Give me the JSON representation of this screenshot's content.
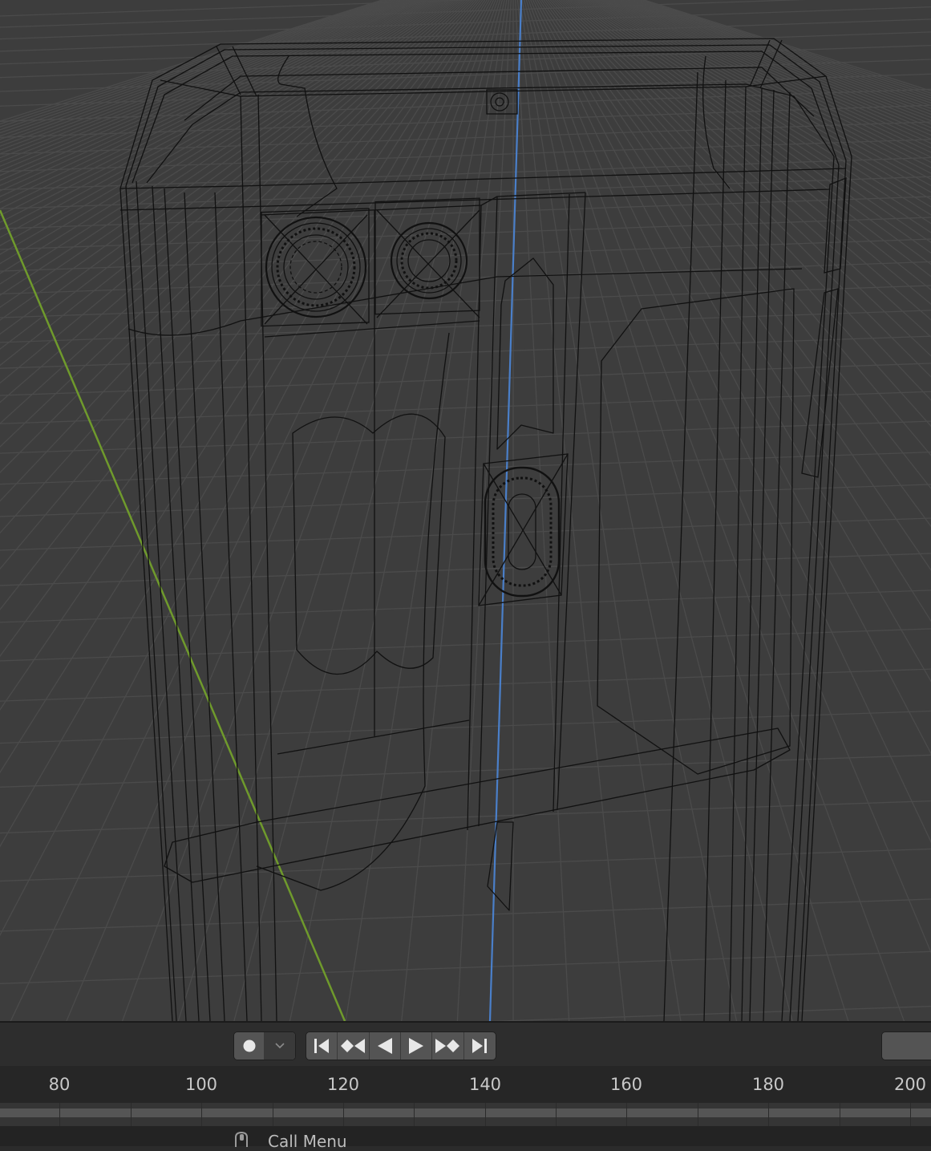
{
  "viewport": {
    "grid_color": "#4a4a4a",
    "background_color": "#3d3d3d",
    "y_axis_color": "#6f9a2c",
    "z_axis_color": "#4a7fc9",
    "wire_color": "#111111"
  },
  "timeline": {
    "record_button_icon": "record-dot-icon",
    "record_dropdown_icon": "chevron-down-icon",
    "playback_controls": [
      {
        "name": "jump-to-start-button",
        "icon": "jump-start-icon"
      },
      {
        "name": "jump-prev-keyframe-button",
        "icon": "prev-keyframe-icon"
      },
      {
        "name": "play-reverse-button",
        "icon": "play-reverse-icon"
      },
      {
        "name": "play-button",
        "icon": "play-icon"
      },
      {
        "name": "jump-next-keyframe-button",
        "icon": "next-keyframe-icon"
      },
      {
        "name": "jump-to-end-button",
        "icon": "jump-end-icon"
      }
    ],
    "frame_ticks": [
      "80",
      "100",
      "120",
      "140",
      "160",
      "180",
      "200"
    ]
  },
  "status_bar": {
    "mouse_icon": "mouse-middle-icon",
    "label": "Call Menu"
  }
}
